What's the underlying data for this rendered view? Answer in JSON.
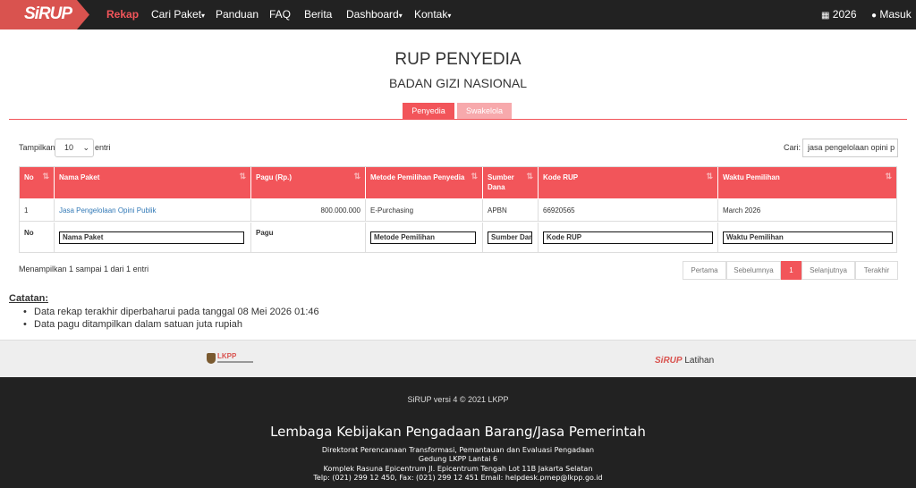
{
  "navbar": {
    "logo": "SiRUP",
    "items": [
      {
        "label": "Rekap",
        "active": true
      },
      {
        "label": "Cari Paket",
        "dropdown": true
      },
      {
        "label": "Panduan"
      },
      {
        "label": "FAQ"
      },
      {
        "label": "Berita"
      },
      {
        "label": "Dashboard",
        "dropdown": true
      },
      {
        "label": "Kontak",
        "dropdown": true
      }
    ],
    "year": "2026",
    "login": "Masuk"
  },
  "page": {
    "title": "RUP PENYEDIA",
    "subtitle": "BADAN GIZI NASIONAL",
    "tabs": [
      "Penyedia",
      "Swakelola"
    ]
  },
  "controls": {
    "show_label": "Tampilkan",
    "show_value": "10",
    "entries_label": "entri",
    "search_label": "Cari:",
    "search_value": "jasa pengelolaan opini p"
  },
  "table": {
    "headers": [
      "No",
      "Nama Paket",
      "Pagu (Rp.)",
      "Metode Pemilihan Penyedia",
      "Sumber Dana",
      "Kode RUP",
      "Waktu Pemilihan"
    ],
    "rows": [
      {
        "no": "1",
        "nama": "Jasa Pengelolaan Opini Publik",
        "pagu": "800.000.000",
        "metode": "E-Purchasing",
        "sumber": "APBN",
        "kode": "66920565",
        "waktu": "March 2026"
      }
    ],
    "footer": {
      "no": "No",
      "nama_placeholder": "Nama Paket",
      "pagu": "Pagu",
      "metode_placeholder": "Metode Pemilihan",
      "sumber_placeholder": "Sumber Dana",
      "kode_placeholder": "Kode RUP",
      "waktu_placeholder": "Waktu Pemilihan"
    }
  },
  "info": "Menampilkan 1 sampai 1 dari 1 entri",
  "pagination": {
    "first": "Pertama",
    "prev": "Sebelumnya",
    "current": "1",
    "next": "Selanjutnya",
    "last": "Terakhir"
  },
  "notes": {
    "title": "Catatan:",
    "items": [
      "Data rekap terakhir diperbaharui pada tanggal 08 Mei 2026 01:46",
      "Data pagu ditampilkan dalam satuan juta rupiah"
    ]
  },
  "logos": {
    "lkpp": "LKPP",
    "sirup": "SiRUP",
    "latihan": "Latihan"
  },
  "footer": {
    "version": "SiRUP versi 4 © 2021 LKPP",
    "org": "Lembaga Kebijakan Pengadaan Barang/Jasa Pemerintah",
    "lines": [
      "Direktorat Perencanaan Transformasi, Pemantauan dan Evaluasi Pengadaan",
      "Gedung LKPP Lantai 6",
      "Komplek Rasuna Epicentrum Jl. Epicentrum Tengah Lot 11B Jakarta Selatan",
      "Telp: (021) 299 12 450, Fax: (021) 299 12 451 Email: helpdesk.pmep@lkpp.go.id"
    ]
  },
  "colors": {
    "accent": "#f2555a",
    "navbar": "#222222",
    "tab_inactive": "#f7a9ac"
  }
}
